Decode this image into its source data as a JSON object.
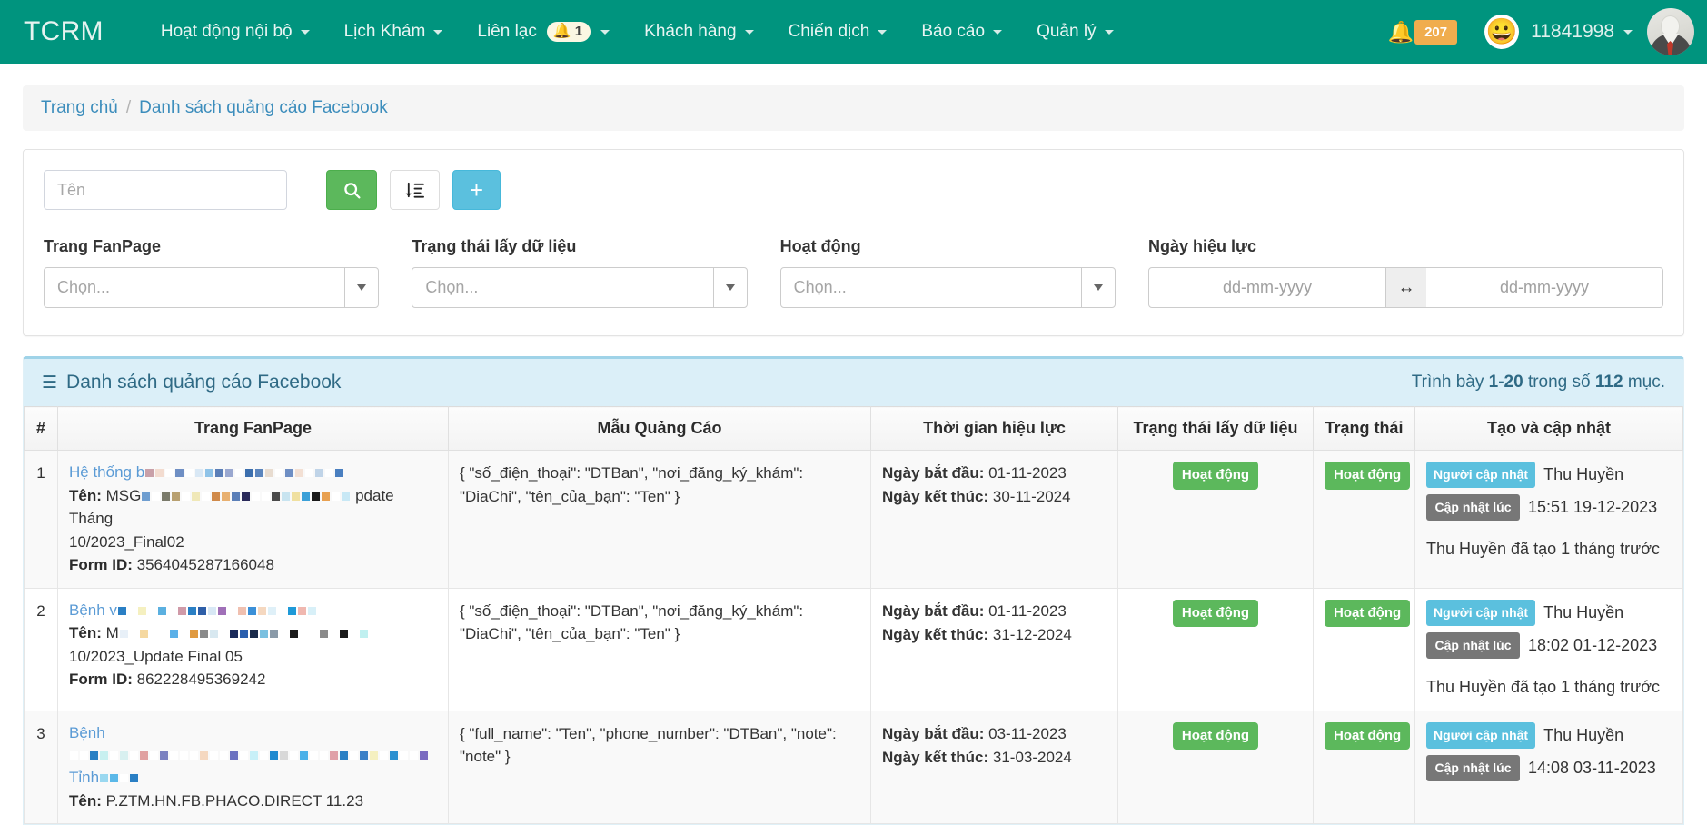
{
  "navbar": {
    "brand": "TCRM",
    "items": [
      {
        "label": "Hoạt động nội bộ",
        "caret": true
      },
      {
        "label": "Lịch Khám",
        "caret": true
      },
      {
        "label": "Liên lạc",
        "caret": true,
        "badge": "1",
        "badge_icon": "bell-icon"
      },
      {
        "label": "Khách hàng",
        "caret": true
      },
      {
        "label": "Chiến dịch",
        "caret": true
      },
      {
        "label": "Báo cáo",
        "caret": true
      },
      {
        "label": "Quản lý",
        "caret": true
      }
    ],
    "alert_count": "207",
    "username": "11841998",
    "smiley": "😀",
    "colors": {
      "bg": "#00947e",
      "alert_badge": "#f0ad4e"
    }
  },
  "breadcrumb": {
    "home": "Trang chủ",
    "separator": "/",
    "current": "Danh sách quảng cáo Facebook"
  },
  "filters": {
    "name_placeholder": "Tên",
    "name_value": "",
    "search_button": "search-icon",
    "sort_button": "sort-descending-icon",
    "add_button": "+",
    "fields": [
      {
        "label": "Trang FanPage",
        "placeholder": "Chọn...",
        "value": "",
        "type": "select"
      },
      {
        "label": "Trạng thái lấy dữ liệu",
        "placeholder": "Chọn...",
        "value": "",
        "type": "select"
      },
      {
        "label": "Hoạt động",
        "placeholder": "Chọn...",
        "value": "",
        "type": "select"
      },
      {
        "label": "Ngày hiệu lực",
        "placeholder": "dd-mm-yyyy",
        "placeholder2": "dd-mm-yyyy",
        "value": "",
        "value2": "",
        "type": "daterange",
        "separator": "↔"
      }
    ]
  },
  "list": {
    "title": "Danh sách quảng cáo Facebook",
    "count_prefix": "Trình bày",
    "count_range": "1-20",
    "count_middle": "trong số",
    "count_total": "112",
    "count_suffix": "mục.",
    "columns": [
      "#",
      "Trang FanPage",
      "Mẫu Quảng Cáo",
      "Thời gian hiệu lực",
      "Trạng thái lấy dữ liệu",
      "Trạng thái",
      "Tạo và cập nhật"
    ],
    "rows": [
      {
        "index": "1",
        "fanpage_prefix": "Hệ thống b",
        "fanpage_redacted": true,
        "name_label": "Tên:",
        "name_prefix": "MSG",
        "name_suffix": "pdate Tháng",
        "name_line2": "10/2023_Final02",
        "form_label": "Form ID:",
        "form_id": "3564045287166048",
        "template": "{ \"số_điện_thoại\": \"DTBan\", \"nơi_đăng_ký_khám\": \"DiaChi\", \"tên_của_bạn\": \"Ten\" }",
        "start_label": "Ngày bắt đầu:",
        "start_date": "01-11-2023",
        "end_label": "Ngày kết thúc:",
        "end_date": "30-11-2024",
        "fetch_status": "Hoạt động",
        "status": "Hoạt động",
        "updater_label": "Người cập nhật",
        "updater": "Thu Huyền",
        "updated_label": "Cập nhật lúc",
        "updated_at": "15:51 19-12-2023",
        "created_note": "Thu Huyền đã tạo 1 tháng trước"
      },
      {
        "index": "2",
        "fanpage_prefix": "Bệnh v",
        "fanpage_redacted": true,
        "name_label": "Tên:",
        "name_prefix": "M",
        "name_suffix": "",
        "name_line2": "10/2023_Update Final 05",
        "form_label": "Form ID:",
        "form_id": "862228495369242",
        "template": "{ \"số_điện_thoại\": \"DTBan\", \"nơi_đăng_ký_khám\": \"DiaChi\", \"tên_của_bạn\": \"Ten\" }",
        "start_label": "Ngày bắt đầu:",
        "start_date": "01-11-2023",
        "end_label": "Ngày kết thúc:",
        "end_date": "31-12-2024",
        "fetch_status": "Hoạt động",
        "status": "Hoạt động",
        "updater_label": "Người cập nhật",
        "updater": "Thu Huyền",
        "updated_label": "Cập nhật lúc",
        "updated_at": "18:02 01-12-2023",
        "created_note": "Thu Huyền đã tạo 1 tháng trước"
      },
      {
        "index": "3",
        "fanpage_prefix": "Bệnh",
        "fanpage_line2": "Tỉnh",
        "fanpage_redacted": true,
        "name_label": "Tên:",
        "name_prefix": "P.ZTM.HN.FB.PHACO.DIRECT 11.23",
        "name_suffix": "",
        "name_line2": "",
        "form_label": "",
        "form_id": "",
        "template": "{ \"full_name\": \"Ten\", \"phone_number\": \"DTBan\", \"note\": \"note\" }",
        "start_label": "Ngày bắt đầu:",
        "start_date": "03-11-2023",
        "end_label": "Ngày kết thúc:",
        "end_date": "31-03-2024",
        "fetch_status": "Hoạt động",
        "status": "Hoạt động",
        "updater_label": "Người cập nhật",
        "updater": "Thu Huyền",
        "updated_label": "Cập nhật lúc",
        "updated_at": "14:08 03-11-2023",
        "created_note": ""
      }
    ]
  }
}
